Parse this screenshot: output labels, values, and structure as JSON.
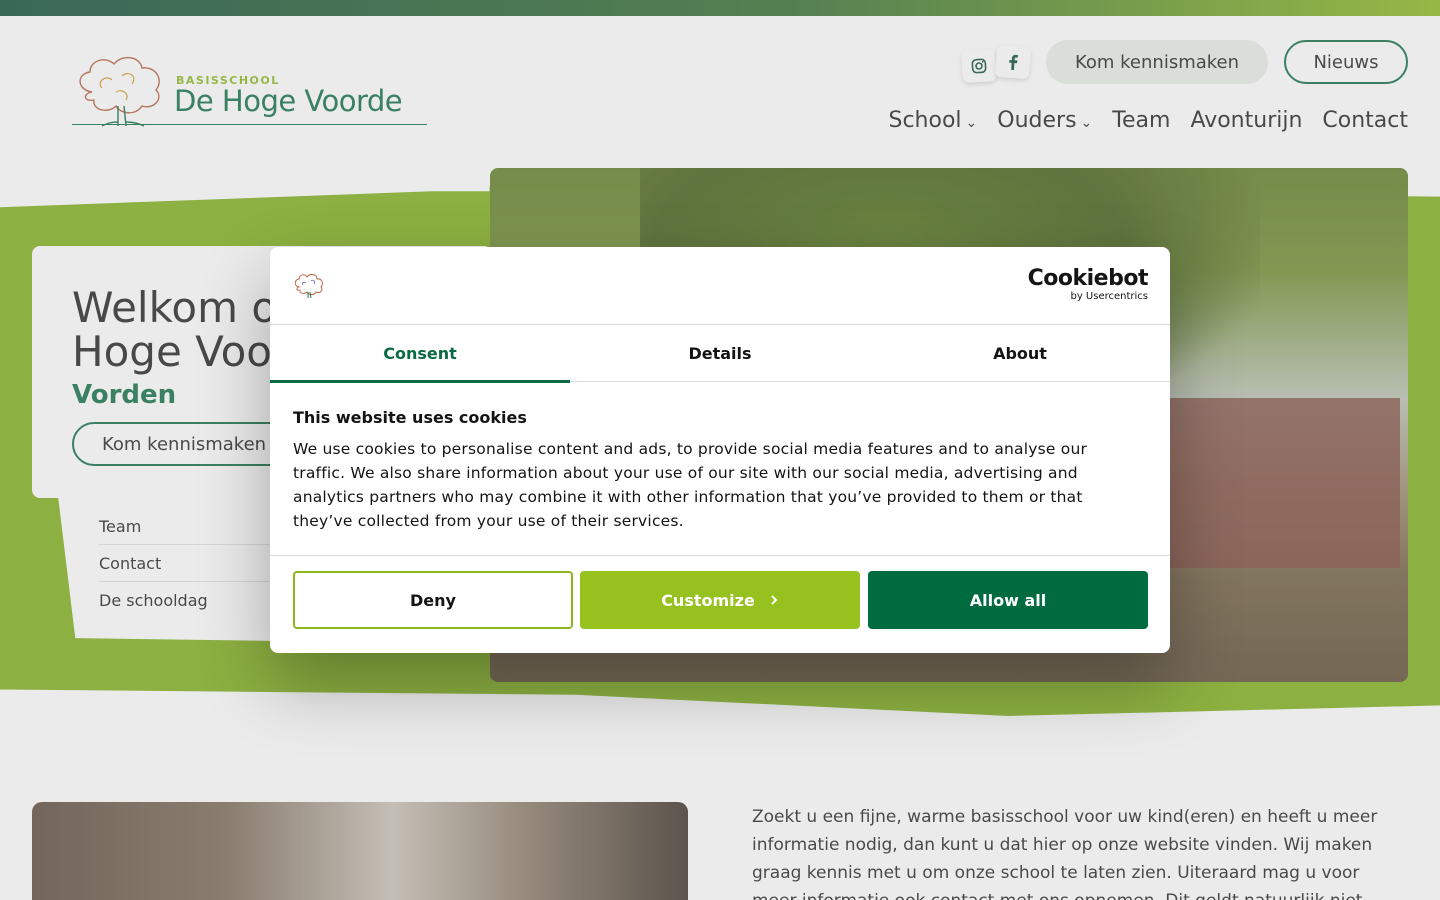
{
  "header": {
    "logo_small": "BASISSCHOOL",
    "logo_big": "De Hoge Voorde",
    "social": [
      {
        "name": "instagram-icon",
        "glyph": "◎"
      },
      {
        "name": "facebook-icon",
        "glyph": "f"
      }
    ],
    "kennis_label": "Kom kennismaken",
    "nieuws_label": "Nieuws",
    "nav": [
      "School",
      "Ouders",
      "Team",
      "Avonturijn",
      "Contact"
    ]
  },
  "hero": {
    "title": "Welkom op De Hoge Voorde",
    "subtitle": "Vorden",
    "button_label": "Kom kennismaken",
    "quick_links": [
      "Team",
      "Contact",
      "De schooldag"
    ]
  },
  "content": {
    "intro": "Zoekt u een fijne, warme basisschool voor uw kind(eren) en heeft u meer informatie nodig, dan kunt u dat hier op onze website vinden. Wij maken graag kennis met u om onze school te laten zien. Uiteraard mag u voor meer informatie ook contact met ons opnemen. Dit geldt natuurlijk niet alleen voor nieuwe ouders en verzorgers maar ook"
  },
  "cookie_dialog": {
    "brand_main": "Cookiebot",
    "brand_sub": "by Usercentrics",
    "tabs": [
      "Consent",
      "Details",
      "About"
    ],
    "active_tab": "Consent",
    "title": "This website uses cookies",
    "body": "We use cookies to personalise content and ads, to provide social media features and to analyse our traffic. We also share information about your use of our site with our social media, advertising and analytics partners who may combine it with other information that you’ve provided to them or that they’ve collected from your use of their services.",
    "deny_label": "Deny",
    "customize_label": "Customize",
    "allow_label": "Allow all"
  },
  "colors": {
    "brand_green": "#0a6b43",
    "lime": "#96c11f",
    "band_green": "#7cae14"
  }
}
